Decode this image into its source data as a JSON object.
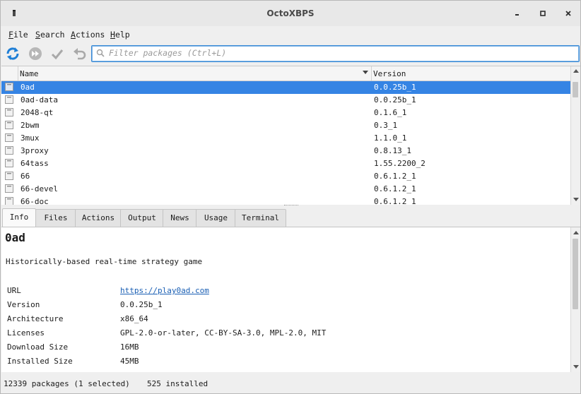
{
  "window": {
    "title": "OctoXBPS"
  },
  "menubar": [
    {
      "label": "File",
      "accel": "F",
      "rest": "ile"
    },
    {
      "label": "Search",
      "accel": "S",
      "rest": "earch"
    },
    {
      "label": "Actions",
      "accel": "A",
      "rest": "ctions"
    },
    {
      "label": "Help",
      "accel": "H",
      "rest": "elp"
    }
  ],
  "toolbar": {
    "filter_placeholder": "Filter packages (Ctrl+L)",
    "filter_value": "",
    "icons": [
      "sync-icon",
      "skip-forward-icon",
      "apply-check-icon",
      "undo-icon"
    ]
  },
  "package_list": {
    "columns": [
      "Name",
      "Version"
    ],
    "sort_column": "Name",
    "rows": [
      {
        "name": "0ad",
        "version": "0.0.25b_1",
        "selected": true
      },
      {
        "name": "0ad-data",
        "version": "0.0.25b_1",
        "selected": false
      },
      {
        "name": "2048-qt",
        "version": "0.1.6_1",
        "selected": false
      },
      {
        "name": "2bwm",
        "version": "0.3_1",
        "selected": false
      },
      {
        "name": "3mux",
        "version": "1.1.0_1",
        "selected": false
      },
      {
        "name": "3proxy",
        "version": "0.8.13_1",
        "selected": false
      },
      {
        "name": "64tass",
        "version": "1.55.2200_2",
        "selected": false
      },
      {
        "name": "66",
        "version": "0.6.1.2_1",
        "selected": false
      },
      {
        "name": "66-devel",
        "version": "0.6.1.2_1",
        "selected": false
      },
      {
        "name": "66-doc",
        "version": "0.6.1.2_1",
        "selected": false
      }
    ]
  },
  "tabs": [
    {
      "label": "Info",
      "active": true
    },
    {
      "label": "Files",
      "active": false
    },
    {
      "label": "Actions",
      "active": false
    },
    {
      "label": "Output",
      "active": false
    },
    {
      "label": "News",
      "active": false
    },
    {
      "label": "Usage",
      "active": false
    },
    {
      "label": "Terminal",
      "active": false
    }
  ],
  "info": {
    "name": "0ad",
    "description": "Historically-based real-time strategy game",
    "fields": [
      {
        "key": "URL",
        "value": "https://play0ad.com",
        "link": true
      },
      {
        "key": "Version",
        "value": "0.0.25b_1",
        "link": false
      },
      {
        "key": "Architecture",
        "value": "x86_64",
        "link": false
      },
      {
        "key": "Licenses",
        "value": "GPL-2.0-or-later, CC-BY-SA-3.0, MPL-2.0, MIT",
        "link": false
      },
      {
        "key": "Download Size",
        "value": "16MB",
        "link": false
      },
      {
        "key": "Installed Size",
        "value": "45MB",
        "link": false
      }
    ]
  },
  "status": {
    "packages": "12339 packages (1 selected)",
    "installed": "525 installed"
  },
  "colors": {
    "selection": "#3584e4",
    "link": "#1a5fb4",
    "focus": "#3a8ad6"
  }
}
